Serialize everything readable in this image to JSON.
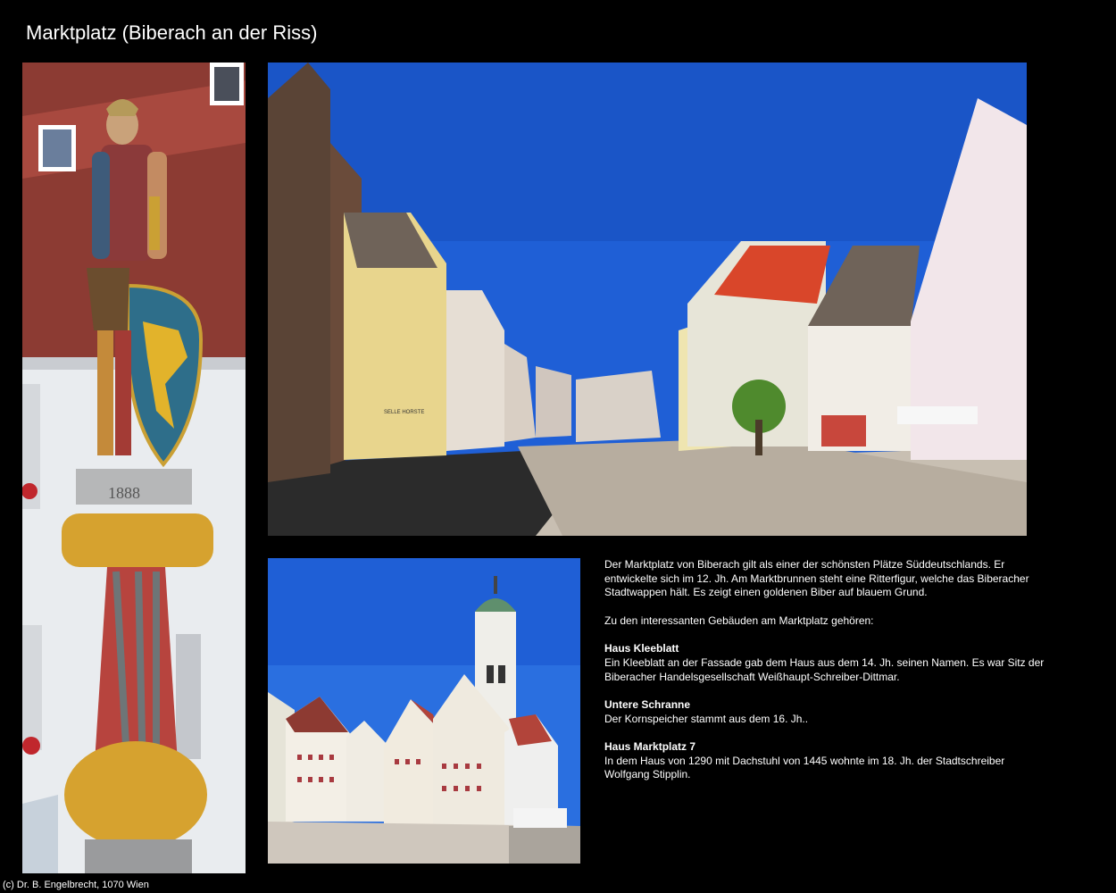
{
  "page": {
    "title": "Marktplatz (Biberach an der Riss)",
    "credit": "(c) Dr. B. Engelbrecht, 1070 Wien"
  },
  "photos": {
    "statue_inscription": "1888",
    "shop_sign": "SELLE HORSTE"
  },
  "description": {
    "intro": "Der Marktplatz von Biberach gilt als einer der schönsten Plätze Süddeutschlands. Er entwickelte sich im 12. Jh. Am Marktbrunnen steht eine Ritterfigur, welche das Biberacher Stadtwappen hält. Es zeigt einen goldenen Biber auf blauem Grund.",
    "lead": "Zu den interessanten Gebäuden am Marktplatz gehören:",
    "sections": [
      {
        "heading": "Haus Kleeblatt",
        "text": "Ein Kleeblatt an der Fassade gab dem Haus aus dem 14. Jh. seinen Namen. Es war Sitz der Biberacher Handelsgesellschaft Weißhaupt-Schreiber-Dittmar."
      },
      {
        "heading": "Untere Schranne",
        "text": "Der Kornspeicher stammt aus dem 16. Jh.."
      },
      {
        "heading": "Haus Marktplatz 7",
        "text": "In dem Haus von 1290 mit Dachstuhl von 1445 wohnte im 18. Jh. der Stadtschreiber Wolfgang Stipplin."
      }
    ]
  },
  "colors": {
    "background": "#000000",
    "text": "#ffffff",
    "sky": "#1f5fd6"
  }
}
